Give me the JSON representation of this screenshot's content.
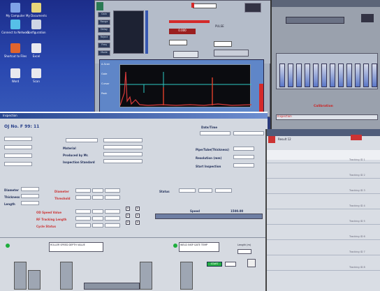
{
  "desktop": {
    "icons": [
      {
        "label": "My Computer"
      },
      {
        "label": "My Documents"
      },
      {
        "label": "Connect to Network"
      },
      {
        "label": "Configuration"
      },
      {
        "label": "Shortcut to Files"
      },
      {
        "label": "Excel"
      },
      {
        "label": "Word"
      },
      {
        "label": "Scan"
      }
    ]
  },
  "analyzer": {
    "left_buttons": [
      "Gain",
      "Range",
      "Delay",
      "Reject",
      "Freq",
      "Mode"
    ],
    "readout_red": "0.000",
    "mode_label": "PULSE",
    "scope_buttons": [
      "A-Scan",
      "Gate",
      "Cursor",
      "Peak"
    ],
    "colors": {
      "scope_bg": "#0b0c10",
      "trace": "#d83a3a",
      "gate": "#2ecac4",
      "echo": "#e0402a"
    }
  },
  "right_panel": {
    "title": "Calibration",
    "footer_label": "Inspection",
    "channels": 12
  },
  "form": {
    "title_bar": "Inspection",
    "header_title": "OJ No. F 99: 11",
    "top_right_label": "Date/Time",
    "left_fields": [
      "",
      "",
      "",
      ""
    ],
    "mid_labels": [
      "Material",
      "Produced by Mr.",
      "Inspection Standard"
    ],
    "right_labels": [
      "Pipe/Tube(Thickness)",
      "Resolution (mm)",
      "Start Inspection"
    ],
    "section_labels": [
      "Diameter",
      "Thickness",
      "Length",
      "Width"
    ],
    "red_labels": [
      "Diameter",
      "Threshold",
      "Tolerance"
    ],
    "lower_red_labels": [
      "OD Speed Value",
      "RF Tracking Length",
      "Cycle Status"
    ],
    "status_label": "Status",
    "bar_label": "Speed",
    "value_label": "1500.00"
  },
  "grid_panel": {
    "title": "Result 12",
    "row_labels": [
      "Tracking ID 1",
      "Tracking ID 2",
      "Tracking ID 3",
      "Tracking ID 4",
      "Tracking ID 5",
      "Tracking ID 6",
      "Tracking ID 7",
      "Tracking ID 8"
    ]
  },
  "process": {
    "box1": "ROLLER  SPEED  DEPTH  VALUE",
    "box2": "WELD  INSP  GATE  TEMP",
    "start_button": "START",
    "small_label": "Length (m)"
  }
}
